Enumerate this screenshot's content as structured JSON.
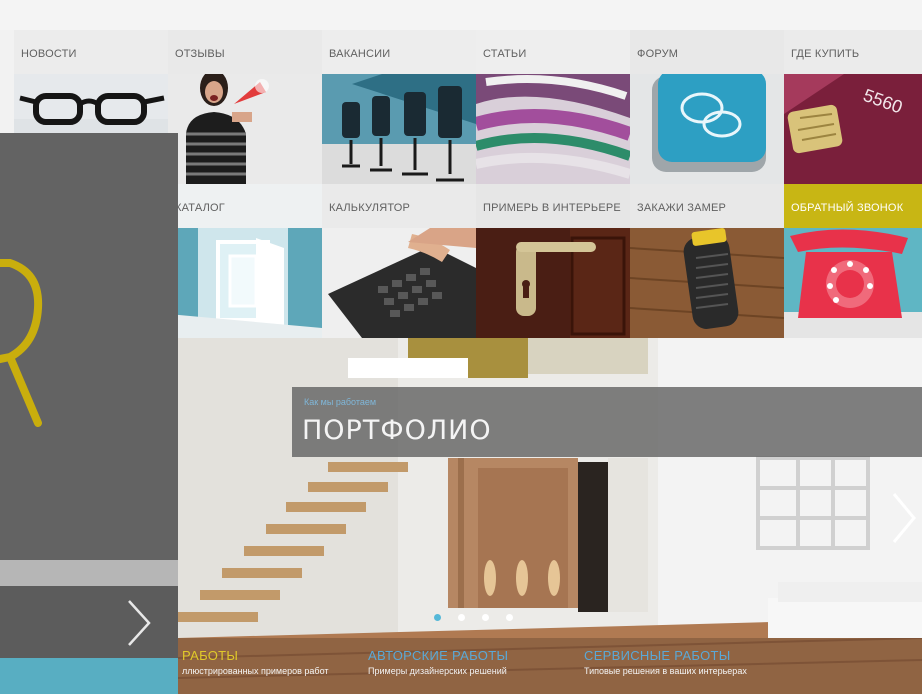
{
  "tiles_row1": [
    {
      "label": "НОВОСТИ",
      "icon": "glasses-icon"
    },
    {
      "label": "ОТЗЫВЫ",
      "icon": "megaphone-woman-icon"
    },
    {
      "label": "ВАКАНСИИ",
      "icon": "office-chairs-icon"
    },
    {
      "label": "СТАТЬИ",
      "icon": "magazine-icon"
    },
    {
      "label": "ФОРУМ",
      "icon": "chat-bubbles-icon"
    },
    {
      "label": "ГДЕ КУПИТЬ",
      "icon": "credit-card-icon"
    }
  ],
  "card_number": "5560",
  "tiles_row2": [
    {
      "label": "КАТАЛОГ",
      "icon": "doors-corridor-icon"
    },
    {
      "label": "КАЛЬКУЛЯТОР",
      "icon": "calculator-icon"
    },
    {
      "label": "ПРИМЕРЬ В ИНТЕРЬЕРЕ",
      "icon": "door-handle-icon"
    },
    {
      "label": "ЗАКАЖИ ЗАМЕР",
      "icon": "tape-measure-icon"
    },
    {
      "label": "ОБРАТНЫЙ ЗВОНОК",
      "icon": "telephone-icon"
    }
  ],
  "hero": {
    "subtitle": "Как мы работаем",
    "title": "ПОРТФОЛИО",
    "slides": 4,
    "active_slide": 1
  },
  "captions": [
    {
      "title": "РАБОТЫ",
      "subtitle": "ллюстрированных примеров работ",
      "color": "#e0c92a"
    },
    {
      "title": "АВТОРСКИЕ РАБОТЫ",
      "subtitle": "Примеры дизайнерских решений",
      "color": "#5aa8d6"
    },
    {
      "title": "СЕРВИСНЫЕ РАБОТЫ",
      "subtitle": "Типовые решения в ваших интерьерах",
      "color": "#5aa8d6"
    }
  ],
  "colors": {
    "accent_yellow": "#c8b614",
    "accent_blue": "#58aec2",
    "panel_gray": "#636363"
  }
}
